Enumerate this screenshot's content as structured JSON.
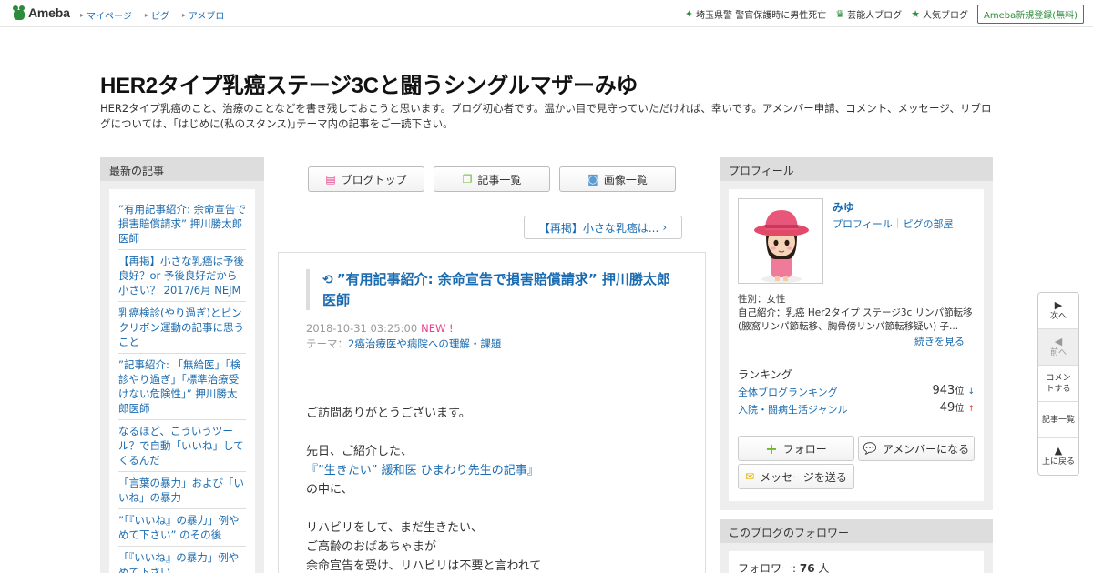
{
  "topbar": {
    "logo": "Ameba",
    "nav": [
      "マイページ",
      "ピグ",
      "アメブロ"
    ],
    "right": [
      {
        "icon": "sparkle-icon",
        "label": "埼玉県警 警官保護時に男性死亡"
      },
      {
        "icon": "crown-icon",
        "label": "芸能人ブログ"
      },
      {
        "icon": "star-icon",
        "label": "人気ブログ"
      }
    ],
    "register": "Ameba新規登録(無料)"
  },
  "header": {
    "title": "HER2タイプ乳癌ステージ3Cと闘うシングルマザーみゆ",
    "description": "HER2タイプ乳癌のこと、治療のことなどを書き残しておこうと思います。ブログ初心者です。温かい目で見守っていただければ、幸いです。アメンバー申請、コメント、メッセージ、リブログについては、｢はじめに(私のスタンス)｣テーマ内の記事をご一読下さい。"
  },
  "left_sidebar": {
    "heading": "最新の記事",
    "items": [
      "”有用記事紹介: 余命宣告で損害賠償請求” 押川勝太郎医師",
      "【再掲】小さな乳癌は予後良好？or 予後良好だから小さい？ 2017/6月 NEJM",
      "乳癌検診(やり過ぎ)とピンクリボン運動の記事に思うこと",
      "”記事紹介: 「無給医」「検診やり過ぎ」「標準治療受けない危険性」” 押川勝太郎医師",
      "なるほど、こういうツール？で自動「いいね」してくるんだ",
      "「言葉の暴力」および「いいね」の暴力",
      "”「『いいね』の暴力」例やめて下さい” のその後",
      "「『いいね』の暴力」例やめて下さい"
    ]
  },
  "center": {
    "nav": [
      {
        "icon": "document-icon",
        "label": "ブログトップ"
      },
      {
        "icon": "list-icon",
        "label": "記事一覧"
      },
      {
        "icon": "camera-icon",
        "label": "画像一覧"
      }
    ],
    "prev_post": "【再掲】小さな乳癌は...",
    "article": {
      "title": "”有用記事紹介: 余命宣告で損害賠償請求” 押川勝太郎医師",
      "date": "2018-10-31 03:25:00",
      "new_badge": "NEW !",
      "theme_label": "テーマ：",
      "theme": "2癌治療医や病院への理解・課題",
      "body": {
        "p1": "ご訪問ありがとうございます。",
        "p2": "先日、ご紹介した、",
        "p3_link": "『”生きたい” 緩和医 ひまわり先生の記事』",
        "p4": "の中に、",
        "p5": "リハビリをして、まだ生きたい、",
        "p6": "ご高齢のおばあちゃまが",
        "p7": "余命宣告を受け、リハビリは不要と言われて"
      }
    }
  },
  "profile": {
    "heading": "プロフィール",
    "name": "みゆ",
    "link_profile": "プロフィール",
    "link_pig": "ピグの部屋",
    "gender": "性別：女性",
    "intro": "自己紹介：乳癌 Her2タイプ ステージ3c リンパ節転移 (腋窩リンパ節転移、胸骨傍リンパ節転移疑い) 子...",
    "more": "続きを見る",
    "ranking_heading": "ランキング",
    "rankings": [
      {
        "name": "全体ブログランキング",
        "value": "943",
        "unit": "位",
        "trend": "↓"
      },
      {
        "name": "入院・闘病生活ジャンル",
        "value": "49",
        "unit": "位",
        "trend": "↑"
      }
    ],
    "follow": "フォロー",
    "amember": "アメンバーになる",
    "message": "メッセージを送る"
  },
  "followers": {
    "heading": "このブログのフォロワー",
    "label": "フォロワー: ",
    "count": "76",
    "unit": " 人"
  },
  "floatnav": {
    "next": "次へ",
    "prev": "前へ",
    "comment": "コメントする",
    "list": "記事一覧",
    "top": "上に戻る"
  },
  "colors": {
    "brand_green": "#2d8c3c",
    "link_blue": "#1a6bb0",
    "new_pink": "#e8418c"
  }
}
